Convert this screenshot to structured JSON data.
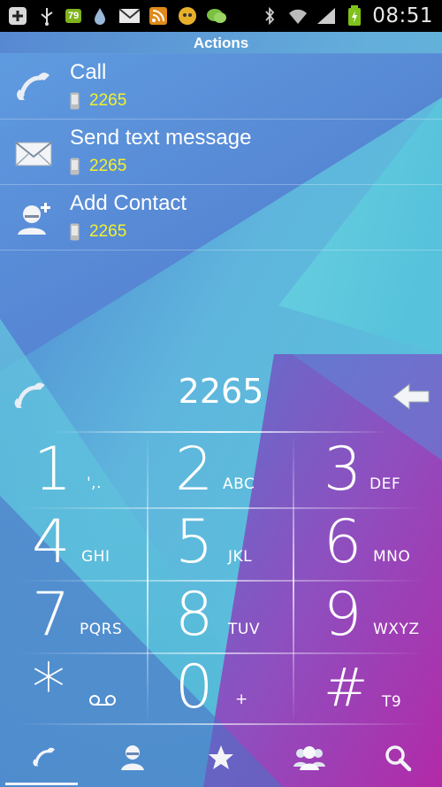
{
  "status_bar": {
    "badge": "79",
    "time": "08:51",
    "icons": [
      "add-icon",
      "usb-icon",
      "battery-level-badge",
      "drop-icon",
      "gmail-icon",
      "rss-icon",
      "fire-icon",
      "chat-icon",
      "bluetooth-icon",
      "wifi-icon",
      "signal-icon",
      "battery-icon"
    ]
  },
  "actions": {
    "header": "Actions",
    "items": [
      {
        "label": "Call",
        "number": "2265",
        "icon": "phone-icon"
      },
      {
        "label": "Send text message",
        "number": "2265",
        "icon": "envelope-icon"
      },
      {
        "label": "Add Contact",
        "number": "2265",
        "icon": "add-contact-icon"
      }
    ]
  },
  "dialer": {
    "number": "2265",
    "keys": [
      {
        "digit": "1",
        "letters": "',."
      },
      {
        "digit": "2",
        "letters": "ABC"
      },
      {
        "digit": "3",
        "letters": "DEF"
      },
      {
        "digit": "4",
        "letters": "GHI"
      },
      {
        "digit": "5",
        "letters": "JKL"
      },
      {
        "digit": "6",
        "letters": "MNO"
      },
      {
        "digit": "7",
        "letters": "PQRS"
      },
      {
        "digit": "8",
        "letters": "TUV"
      },
      {
        "digit": "9",
        "letters": "WXYZ"
      },
      {
        "digit": "*",
        "letters": ""
      },
      {
        "digit": "0",
        "letters": "+"
      },
      {
        "digit": "#",
        "letters": "T9"
      }
    ]
  },
  "tabs": [
    {
      "name": "phone",
      "icon": "phone-icon",
      "active": true
    },
    {
      "name": "contacts",
      "icon": "person-icon",
      "active": false
    },
    {
      "name": "favorites",
      "icon": "star-icon",
      "active": false
    },
    {
      "name": "groups",
      "icon": "group-icon",
      "active": false
    },
    {
      "name": "search",
      "icon": "search-icon",
      "active": false
    }
  ],
  "colors": {
    "number_highlight": "#f4f22a",
    "background_top": "#4e7bd0",
    "background_cyan": "#58c6dc",
    "background_magenta": "#b230a8"
  }
}
